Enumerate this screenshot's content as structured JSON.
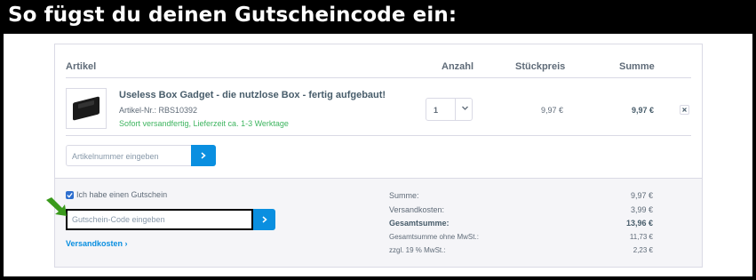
{
  "banner": {
    "title": "So fügst du deinen Gutscheincode ein:"
  },
  "table": {
    "headers": {
      "article": "Artikel",
      "quantity": "Anzahl",
      "unit_price": "Stückpreis",
      "total": "Summe"
    }
  },
  "item": {
    "title": "Useless Box Gadget - die nutzlose Box - fertig aufgebaut!",
    "sku": "Artikel-Nr.: RBS10392",
    "delivery": "Sofort versandfertig, Lieferzeit ca. 1-3 Werktage",
    "quantity": "1",
    "unit_price": "9,97 €",
    "total": "9,97 €",
    "thumbnail_icon": "useless-box-image",
    "remove_icon": "close-icon"
  },
  "add_by_sku": {
    "placeholder": "Artikelnummer eingeben",
    "button_icon": "chevron-right-icon"
  },
  "voucher": {
    "checkbox_label": "Ich habe einen Gutschein",
    "checked": true,
    "placeholder": "Gutschein-Code eingeben",
    "button_icon": "chevron-right-icon",
    "shipping_link": "Versandkosten ›"
  },
  "summary": [
    {
      "label": "Summe:",
      "value": "9,97 €",
      "bold": false,
      "small": false
    },
    {
      "label": "Versandkosten:",
      "value": "3,99 €",
      "bold": false,
      "small": false
    },
    {
      "label": "Gesamtsumme:",
      "value": "13,96 €",
      "bold": true,
      "small": false
    },
    {
      "label": "Gesamtsumme ohne MwSt.:",
      "value": "11,73 €",
      "bold": false,
      "small": true
    },
    {
      "label": "zzgl. 19 % MwSt.:",
      "value": "2,23 €",
      "bold": false,
      "small": true
    }
  ],
  "colors": {
    "accent": "#0a8fe0",
    "success": "#3fb560",
    "annotation_arrow": "#3a9a1c"
  }
}
